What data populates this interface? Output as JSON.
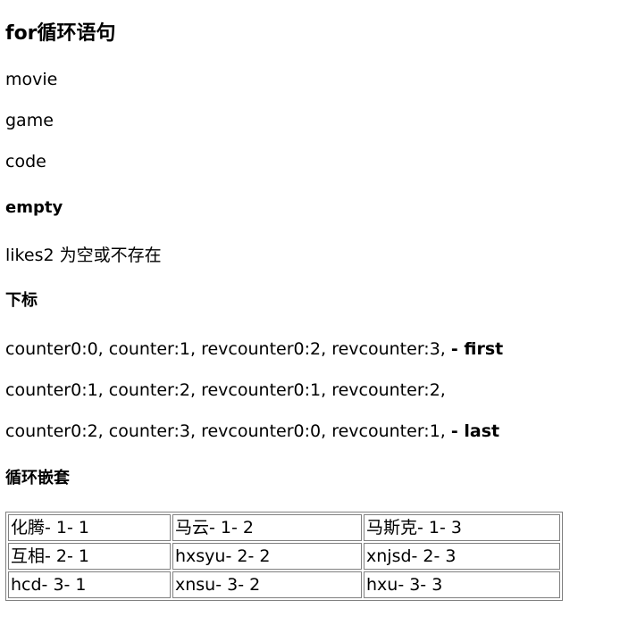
{
  "title": "for循环语句",
  "items": [
    "movie",
    "game",
    "code"
  ],
  "empty_heading": "empty",
  "empty_text": "likes2 为空或不存在",
  "index_heading": "下标",
  "index_rows": [
    {
      "text": "counter0:0, counter:1, revcounter0:2, revcounter:3,",
      "tag": "- first"
    },
    {
      "text": "counter0:1, counter:2, revcounter0:1, revcounter:2,",
      "tag": ""
    },
    {
      "text": "counter0:2, counter:3, revcounter0:0, revcounter:1,",
      "tag": "- last"
    }
  ],
  "nested_heading": "循环嵌套",
  "table": {
    "rows": [
      [
        "化腾- 1- 1",
        "马云- 1- 2",
        "马斯克- 1- 3"
      ],
      [
        "互相- 2- 1",
        "hxsyu- 2- 2",
        "xnjsd- 2- 3"
      ],
      [
        "hcd- 3- 1",
        "xnsu- 3- 2",
        "hxu- 3- 3"
      ]
    ]
  }
}
